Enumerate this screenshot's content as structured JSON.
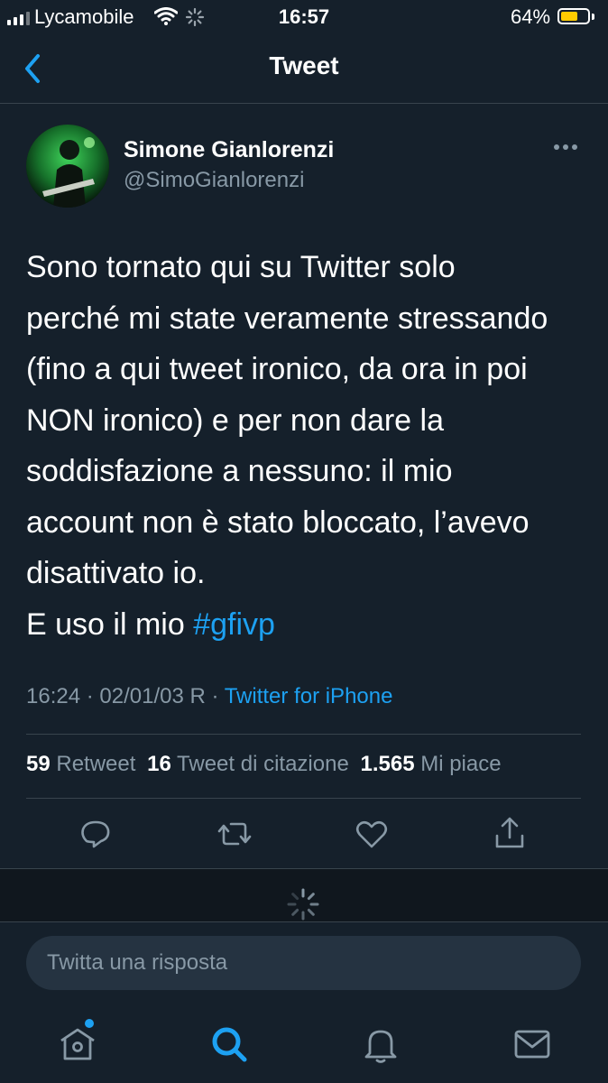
{
  "status_bar": {
    "carrier": "Lycamobile",
    "time": "16:57",
    "battery_percent": "64%",
    "battery_level": 0.64,
    "icons": [
      "signal-icon",
      "wifi-icon",
      "activity-icon",
      "battery-icon"
    ]
  },
  "nav": {
    "title": "Tweet",
    "back_icon": "chevron-left-icon"
  },
  "tweet": {
    "author_name": "Simone Gianlorenzi",
    "author_handle": "@SimoGianlorenzi",
    "more_icon": "ellipsis-icon",
    "text_lines": [
      "Sono tornato qui su Twitter solo",
      "perché mi state veramente stressando",
      "(fino a qui tweet ironico, da ora in poi",
      "NON ironico) e per non dare la",
      "soddisfazione a nessuno: il mio",
      "account non è stato bloccato, l’avevo",
      "disattivato io."
    ],
    "last_line_prefix": "E uso il mio ",
    "hashtag": "#gfivp",
    "timestamp": "16:24 · 02/01/03 R · ",
    "source": "Twitter for iPhone",
    "retweets_count": "59",
    "retweets_label": " Retweet",
    "quotes_count": "16",
    "quotes_label": " Tweet di citazione",
    "likes_count": "1.565",
    "likes_label": " Mi piace"
  },
  "actions": [
    "reply-icon",
    "retweet-icon",
    "like-icon",
    "share-icon"
  ],
  "reply": {
    "placeholder": "Twitta una risposta"
  },
  "tab_bar": {
    "tabs": [
      "home-icon",
      "search-icon",
      "notifications-icon",
      "messages-icon"
    ],
    "active": "search-icon",
    "accent": "#1da1f2"
  },
  "colors": {
    "background": "#15202b",
    "secondary_text": "#8899a6",
    "accent": "#1da1f2",
    "divider": "#38444d"
  }
}
